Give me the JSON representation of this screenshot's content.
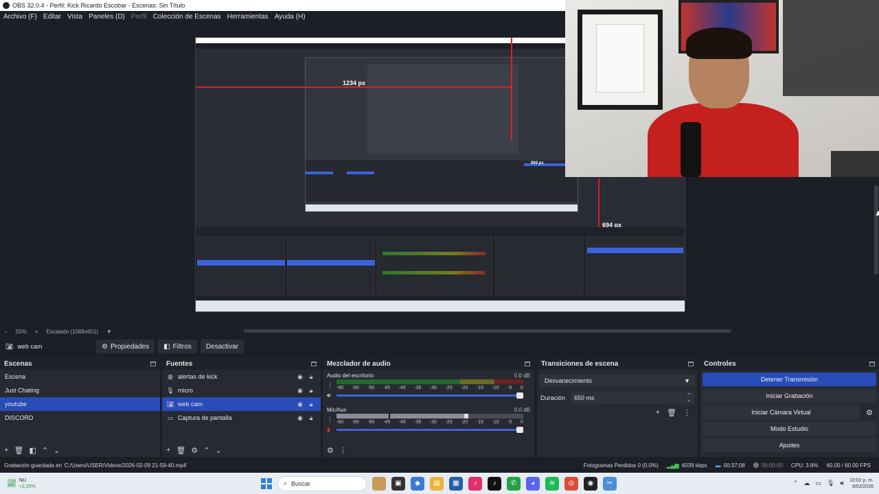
{
  "window": {
    "title": "OBS 32.0.4 - Perfil: Kick Ricardo Escobar - Escenas: Sin Título"
  },
  "menu": [
    "Archivo (F)",
    "Editar",
    "Vista",
    "Paneles (D)",
    "Perfil",
    "Colección de Escenas",
    "Herramientas",
    "Ayuda (H)"
  ],
  "preview": {
    "label_width": "1234 px",
    "label_height_inner": "694 px",
    "label_height": "694 px",
    "zoom": "55%",
    "scaling": "Escalado (1069x601)"
  },
  "source_toolbar": {
    "source_name": "web cam",
    "properties": "Propiedades",
    "filters": "Filtros",
    "deactivate": "Desactivar"
  },
  "scenes": {
    "title": "Escenas",
    "items": [
      "Escena",
      "Just Chating",
      "youtube",
      "DISCORD"
    ],
    "selected_index": 2
  },
  "sources": {
    "title": "Fuentes",
    "items": [
      {
        "name": "alertas de kick",
        "icon": "globe-icon"
      },
      {
        "name": "micro",
        "icon": "microphone-icon"
      },
      {
        "name": "web cam",
        "icon": "camera-icon"
      },
      {
        "name": "Captura de pantalla",
        "icon": "monitor-icon"
      }
    ],
    "selected_index": 2
  },
  "mixer": {
    "title": "Mezclador de audio",
    "ticks": [
      "-60",
      "-55",
      "-50",
      "-45",
      "-40",
      "-35",
      "-30",
      "-25",
      "-20",
      "-15",
      "-10",
      "-5",
      "0"
    ],
    "channels": [
      {
        "name": "Audio del escritorio",
        "db": "0.0 dB",
        "volume": 1.0,
        "muted": false
      },
      {
        "name": "Mic/Aux",
        "db": "0.0 dB",
        "volume": 1.0,
        "muted": false
      }
    ]
  },
  "transitions": {
    "title": "Transiciones de escena",
    "selected": "Desvanecimiento",
    "duration_label": "Duración",
    "duration_value": "650 ms"
  },
  "controls": {
    "title": "Controles",
    "stop_stream": "Detener Transmisión",
    "start_record": "Iniciar Grabación",
    "start_virtualcam": "Iniciar Cámara Virtual",
    "studio_mode": "Modo Estudio",
    "settings": "Ajustes"
  },
  "status": {
    "message": "Grabación guardada en 'C:/Users/USER/Videos/2026-02-09 21-59-40.mp4'",
    "dropped_frames": "Fotogramas Perdidos 0 (0.0%)",
    "bitrate": "6039 kbps",
    "stream_time": "00:37:08",
    "record_time": "00:00:00",
    "cpu": "CPU: 3.8%",
    "fps": "60.00 / 60.00 FPS"
  },
  "taskbar": {
    "stock_name": "NU",
    "stock_change": "+2,20%",
    "search_placeholder": "Buscar",
    "time": "10:02 p. m.",
    "date": "9/02/2026"
  },
  "colors": {
    "accent": "#284cb8",
    "background": "#1d1f26",
    "dock": "#272a33",
    "guide": "#e02020",
    "bitrate_indicator": "#3fbf55"
  }
}
